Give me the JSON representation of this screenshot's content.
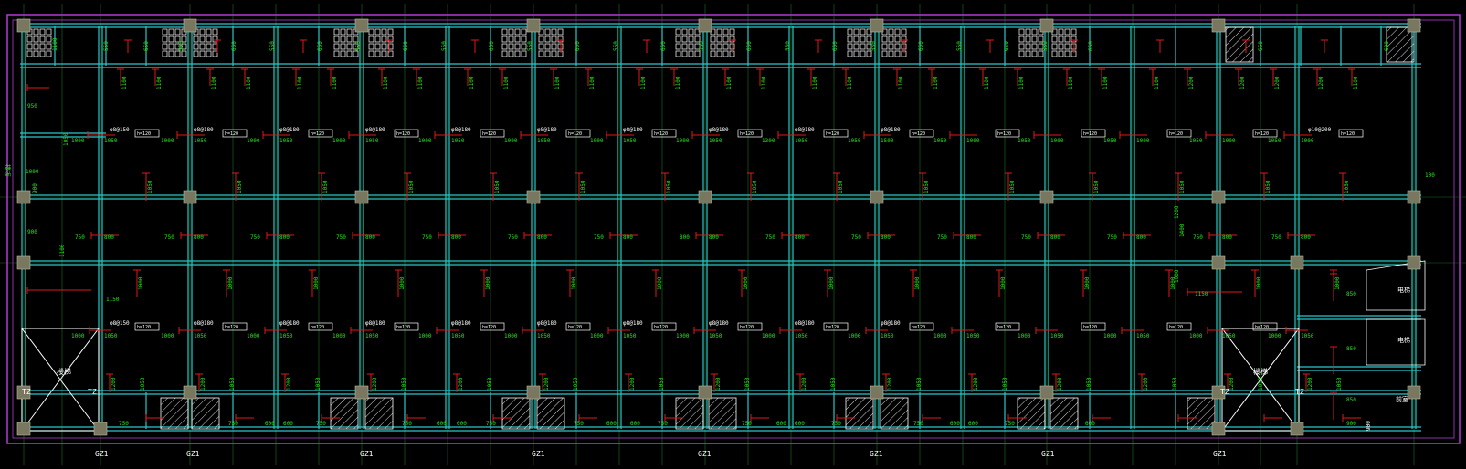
{
  "palette": {
    "background": "#000000",
    "wall": "#29c7c9",
    "wall_inner": "#1a8a8c",
    "grid_line": "#2ecc40",
    "outline": "#b23bd6",
    "rebar": "#e01818",
    "dimension_text": "#26e61e",
    "column_fill": "#7a7760",
    "label_white": "#ffffff"
  },
  "column_labels": [
    "GZ1",
    "GZ1",
    "GZ1",
    "GZ1",
    "GZ1",
    "GZ1",
    "GZ1",
    "GZ1"
  ],
  "tz_labels": [
    "TZ",
    "TZ",
    "TZ",
    "TZ"
  ],
  "thickness_labels": [
    "h=120",
    "h=120",
    "h=120",
    "h=120",
    "h=120",
    "h=120",
    "h=120",
    "h=120",
    "h=120",
    "h=120",
    "h=120",
    "h=120",
    "h=120",
    "h=120",
    "h=120",
    "h=120",
    "h=120",
    "h=120",
    "h=120",
    "h=120",
    "h=120",
    "h=120",
    "h=120",
    "h=120",
    "h=120",
    "h=120",
    "h=120",
    "h=120",
    "h=120",
    "h=120"
  ],
  "rebar_specs_row1": [
    "φ8@150",
    "φ8@180",
    "φ8@180",
    "φ8@180",
    "φ8@180",
    "φ8@180",
    "φ8@180",
    "φ8@180",
    "φ8@180",
    "φ8@180",
    "φ10@200"
  ],
  "rebar_specs_row2": [
    "φ8@150",
    "φ8@180",
    "φ8@180",
    "φ8@180",
    "φ8@180",
    "φ8@180",
    "φ8@180",
    "φ8@180",
    "φ8@180",
    "φ8@180"
  ],
  "top_strip_dims": [
    "1100",
    "550",
    "650",
    "550",
    "650",
    "550",
    "650",
    "550",
    "650",
    "550",
    "650",
    "550",
    "650",
    "550",
    "650",
    "550",
    "650",
    "550",
    "650",
    "550",
    "650",
    "550",
    "650",
    "550",
    "650",
    "650",
    "600"
  ],
  "room_dims_a": [
    "1100",
    "1100",
    "1100",
    "1100",
    "1100",
    "1100",
    "1100",
    "1100",
    "1100",
    "1100",
    "1100",
    "1100",
    "1100",
    "1200",
    "1200"
  ],
  "room_dims_b": [
    "1050",
    "1000",
    "1050",
    "1000",
    "1050",
    "1000",
    "1050",
    "1000",
    "1050",
    "1000",
    "1050",
    "1000",
    "1050",
    "1000",
    "1050",
    "1000",
    "1050",
    "1000",
    "1050",
    "1300",
    "1500"
  ],
  "corridor_dims": [
    "800",
    "750",
    "800",
    "750",
    "800",
    "750",
    "800",
    "750",
    "800",
    "750",
    "800",
    "750",
    "800",
    "750",
    "800",
    "750",
    "800",
    "800"
  ],
  "bottom_strip_dims": [
    "750",
    "750",
    "600",
    "600",
    "750",
    "750",
    "600",
    "600",
    "750",
    "750",
    "600",
    "600",
    "750",
    "750",
    "600",
    "600",
    "750",
    "750",
    "600",
    "600",
    "750",
    "600"
  ],
  "right_side_dims": [
    "850",
    "850",
    "850",
    "900"
  ],
  "misc_labels": [
    "1150",
    "1150",
    "950",
    "900",
    "1000",
    "1050",
    "1200",
    "1000",
    "1400",
    "900",
    "1100",
    "100"
  ],
  "stair_labels": [
    "楼梯",
    "楼梯"
  ],
  "right_room_labels": [
    "电梯",
    "电梯",
    "电梯",
    "前室",
    "前室"
  ],
  "left_vertical_label": "楼板",
  "bottom_label": "900"
}
